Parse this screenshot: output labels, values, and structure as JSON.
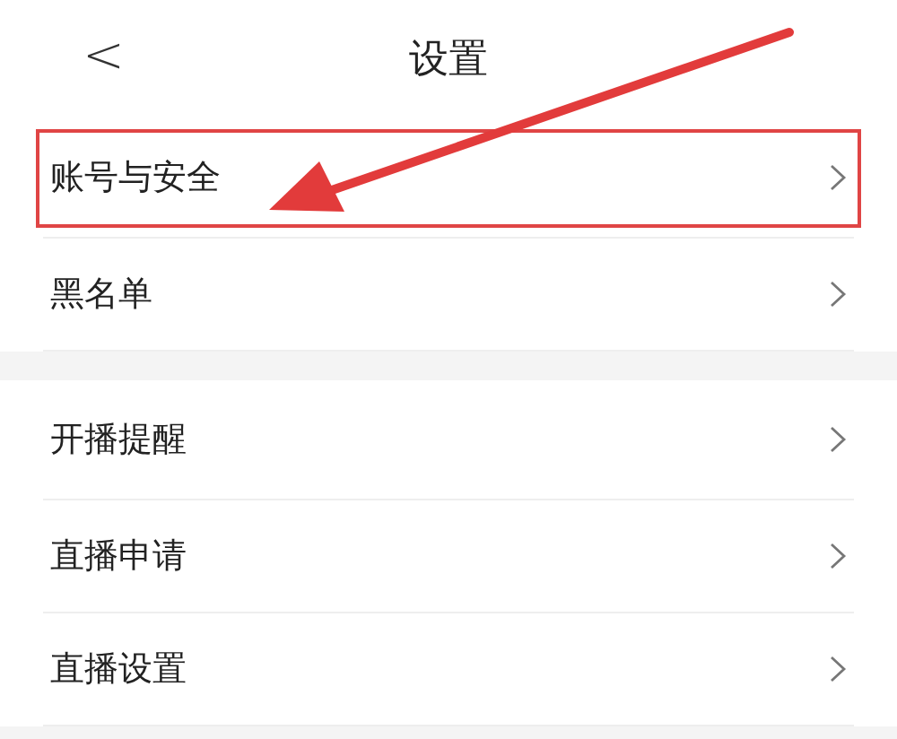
{
  "header": {
    "back": "<",
    "title": "设置"
  },
  "groups": [
    {
      "rows": [
        {
          "label": "账号与安全",
          "highlighted": true
        },
        {
          "label": "黑名单",
          "highlighted": false
        }
      ]
    },
    {
      "rows": [
        {
          "label": "开播提醒",
          "highlighted": false
        },
        {
          "label": "直播申请",
          "highlighted": false
        },
        {
          "label": "直播设置",
          "highlighted": false
        }
      ]
    }
  ]
}
